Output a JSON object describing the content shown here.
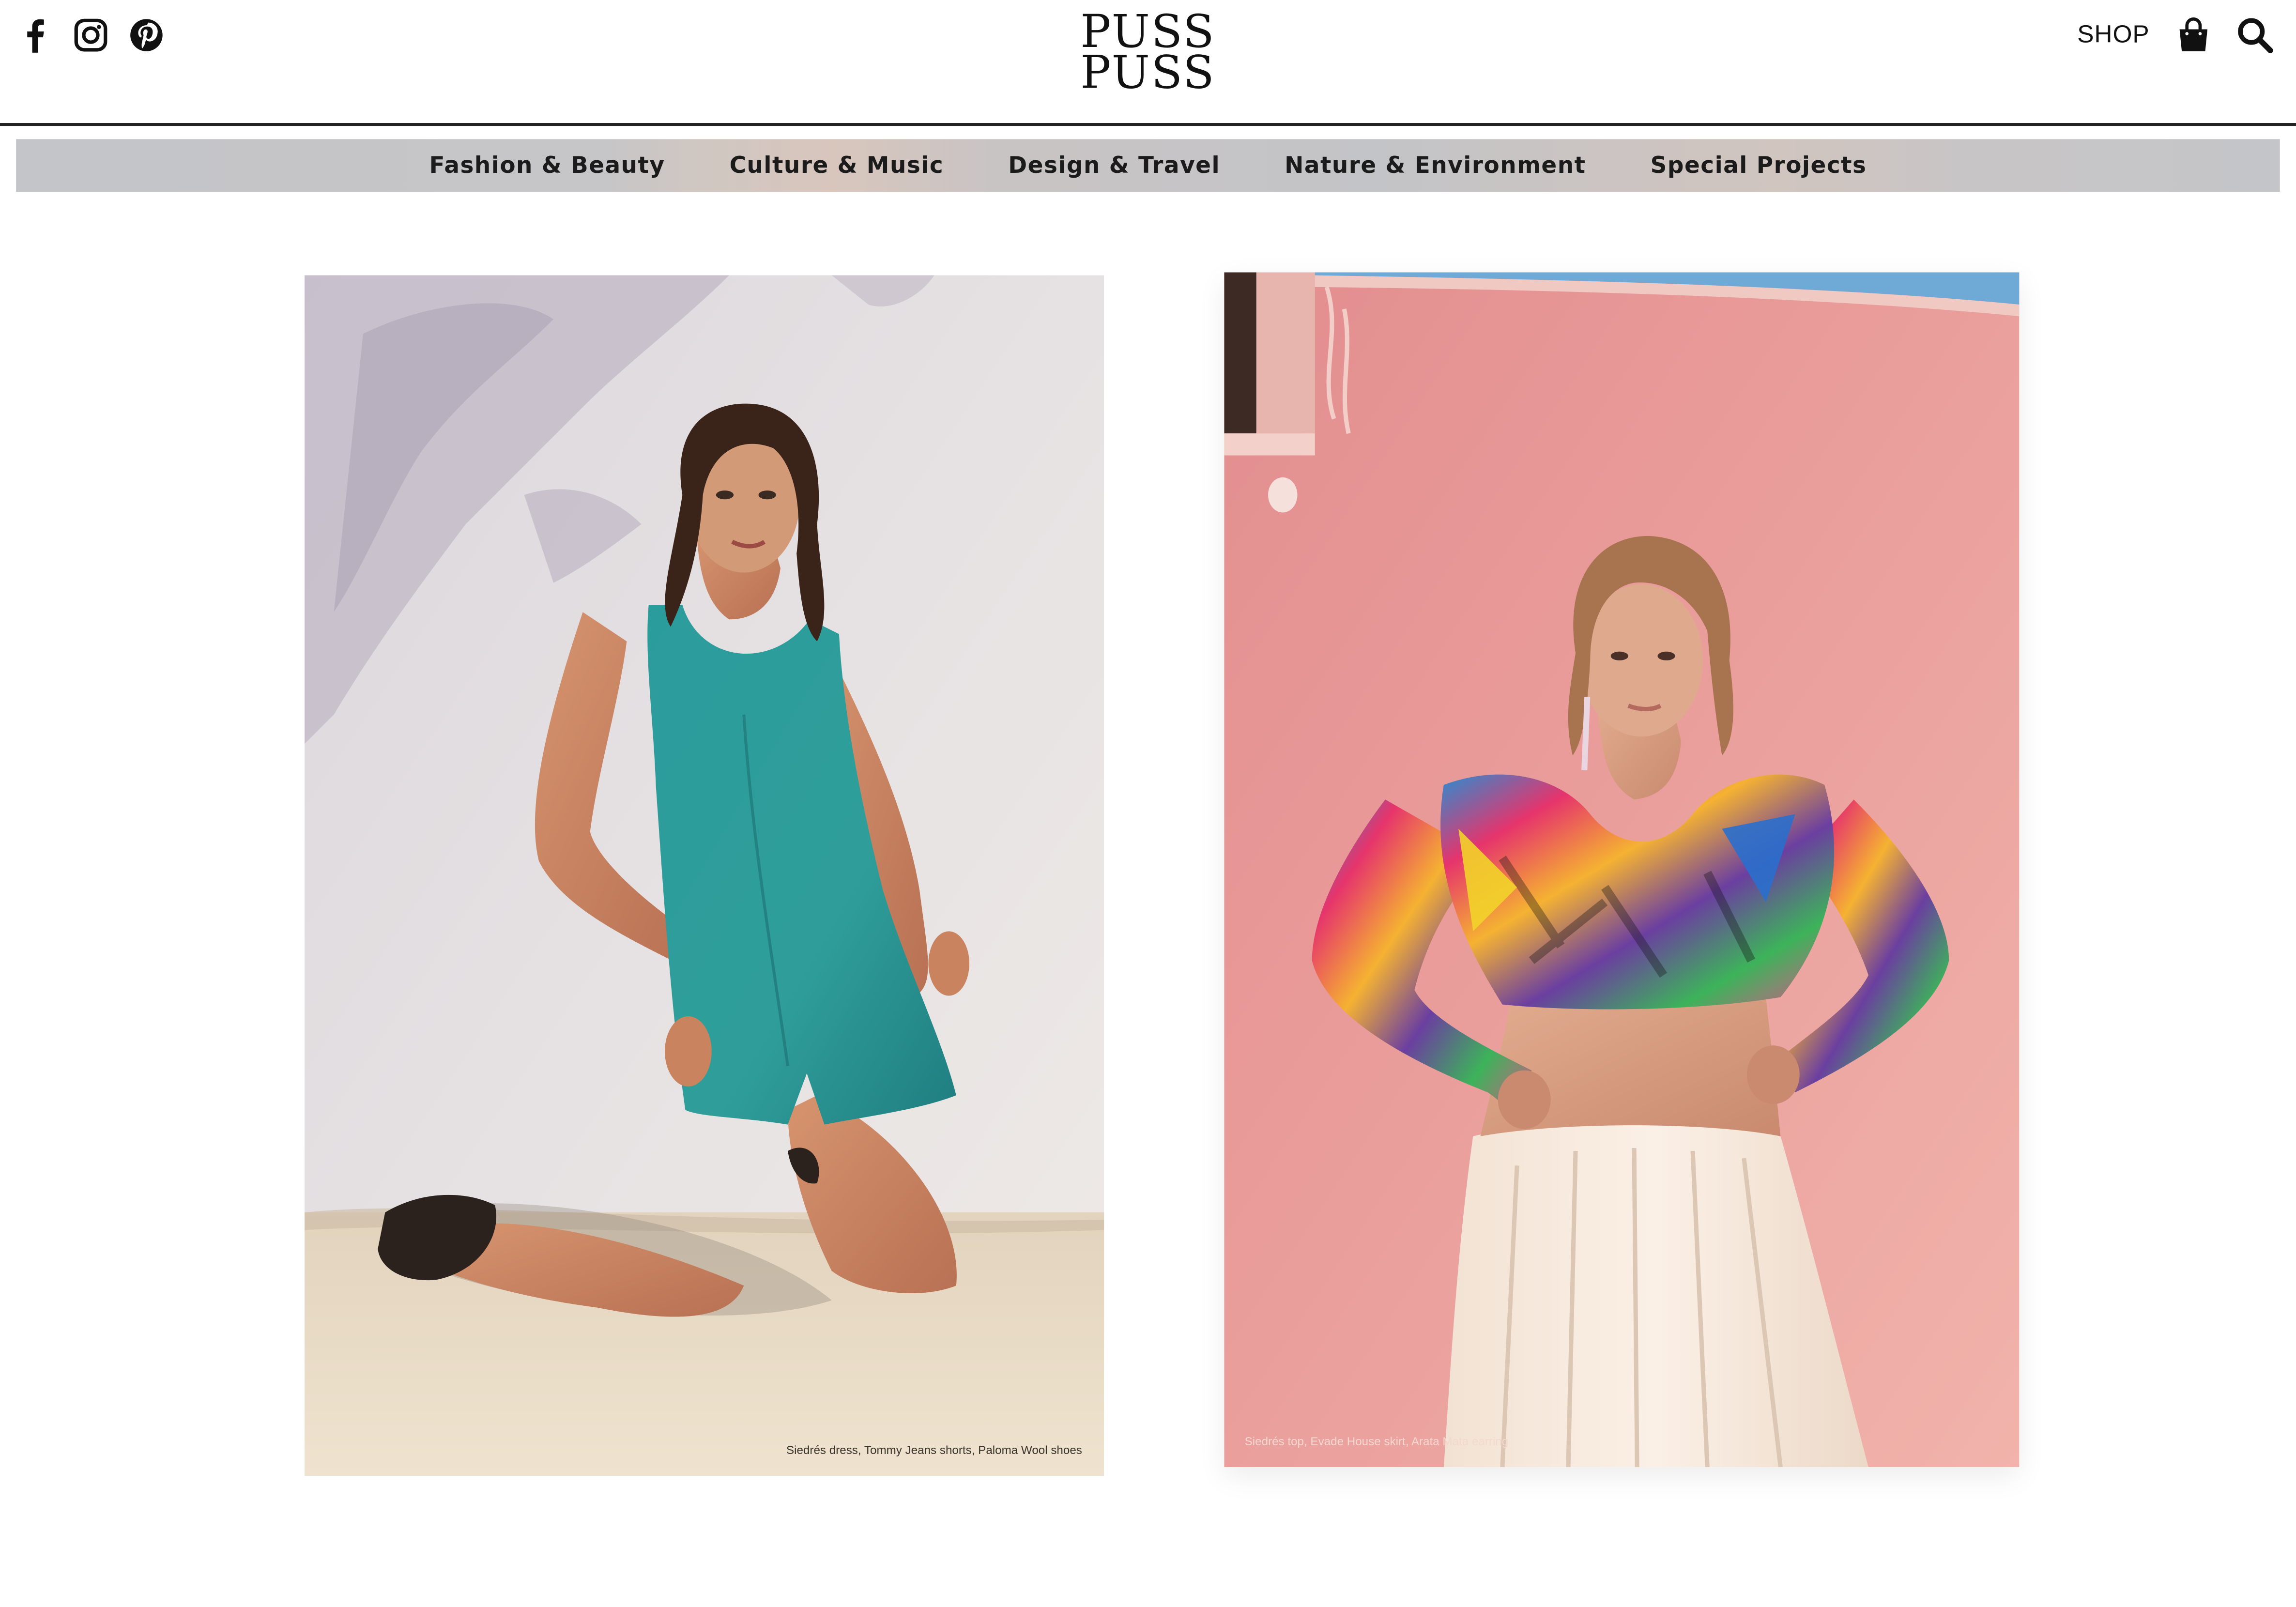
{
  "header": {
    "logo_line1": "PUSS",
    "logo_line2": "PUSS",
    "social": [
      {
        "icon": "facebook-icon"
      },
      {
        "icon": "instagram-icon"
      },
      {
        "icon": "pinterest-icon"
      }
    ],
    "shop_label": "SHOP",
    "cart_icon": "shopping-bag-icon",
    "search_icon": "search-icon"
  },
  "nav": {
    "items": [
      {
        "label": "Fashion & Beauty"
      },
      {
        "label": "Culture & Music"
      },
      {
        "label": "Design & Travel"
      },
      {
        "label": "Nature & Environment"
      },
      {
        "label": "Special Projects"
      }
    ]
  },
  "photos": [
    {
      "caption": "Siedrés dress, Tommy Jeans shorts, Paloma Wool shoes"
    },
    {
      "caption": "Siedrés top, Evade House skirt, Arata Mata earring"
    }
  ],
  "colors": {
    "text": "#111111",
    "nav_bg": "#c4c5c8",
    "header_rule": "#222222"
  }
}
